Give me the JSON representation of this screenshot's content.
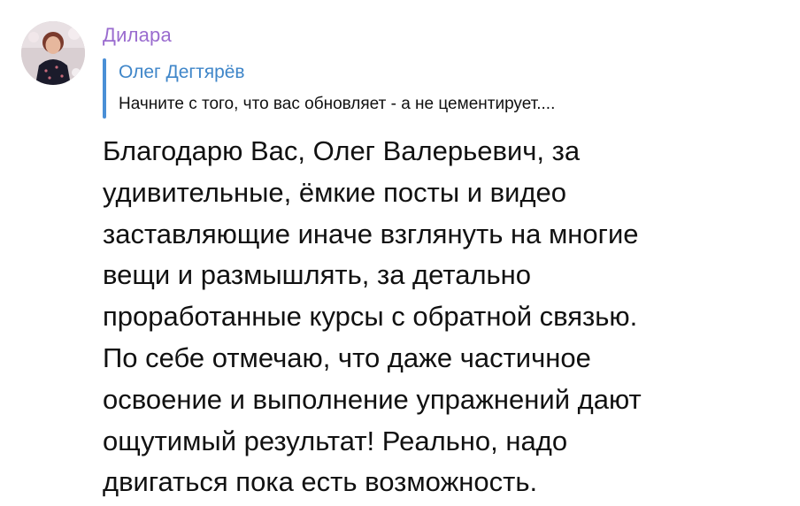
{
  "message": {
    "sender_name": "Дилара",
    "avatar": {
      "icon": "user-photo-avatar",
      "colors": {
        "background": "#d9cfd2",
        "hair": "#7a3a2c",
        "face": "#e6b79d",
        "dress": "#1b1b2b"
      }
    },
    "reply": {
      "author": "Олег Дегтярёв",
      "text": "Начните с того, что вас обновляет - а не цементирует...."
    },
    "body_lines": [
      "Благодарю Вас, Олег Валерьевич, за",
      "удивительные, ёмкие посты и видео",
      "заставляющие иначе взглянуть на многие",
      "вещи и размышлять, за детально",
      "проработанные курсы с обратной связью.",
      "По себе отмечаю,  что даже частичное",
      "освоение и выполнение упражнений дают",
      "ощутимый результат! Реально, надо",
      "двигаться пока есть возможность."
    ]
  },
  "colors": {
    "sender_name": "#9a6ccf",
    "reply_author": "#3f86c9",
    "reply_bar": "#4a8fd6",
    "text": "#111111",
    "background": "#ffffff"
  }
}
